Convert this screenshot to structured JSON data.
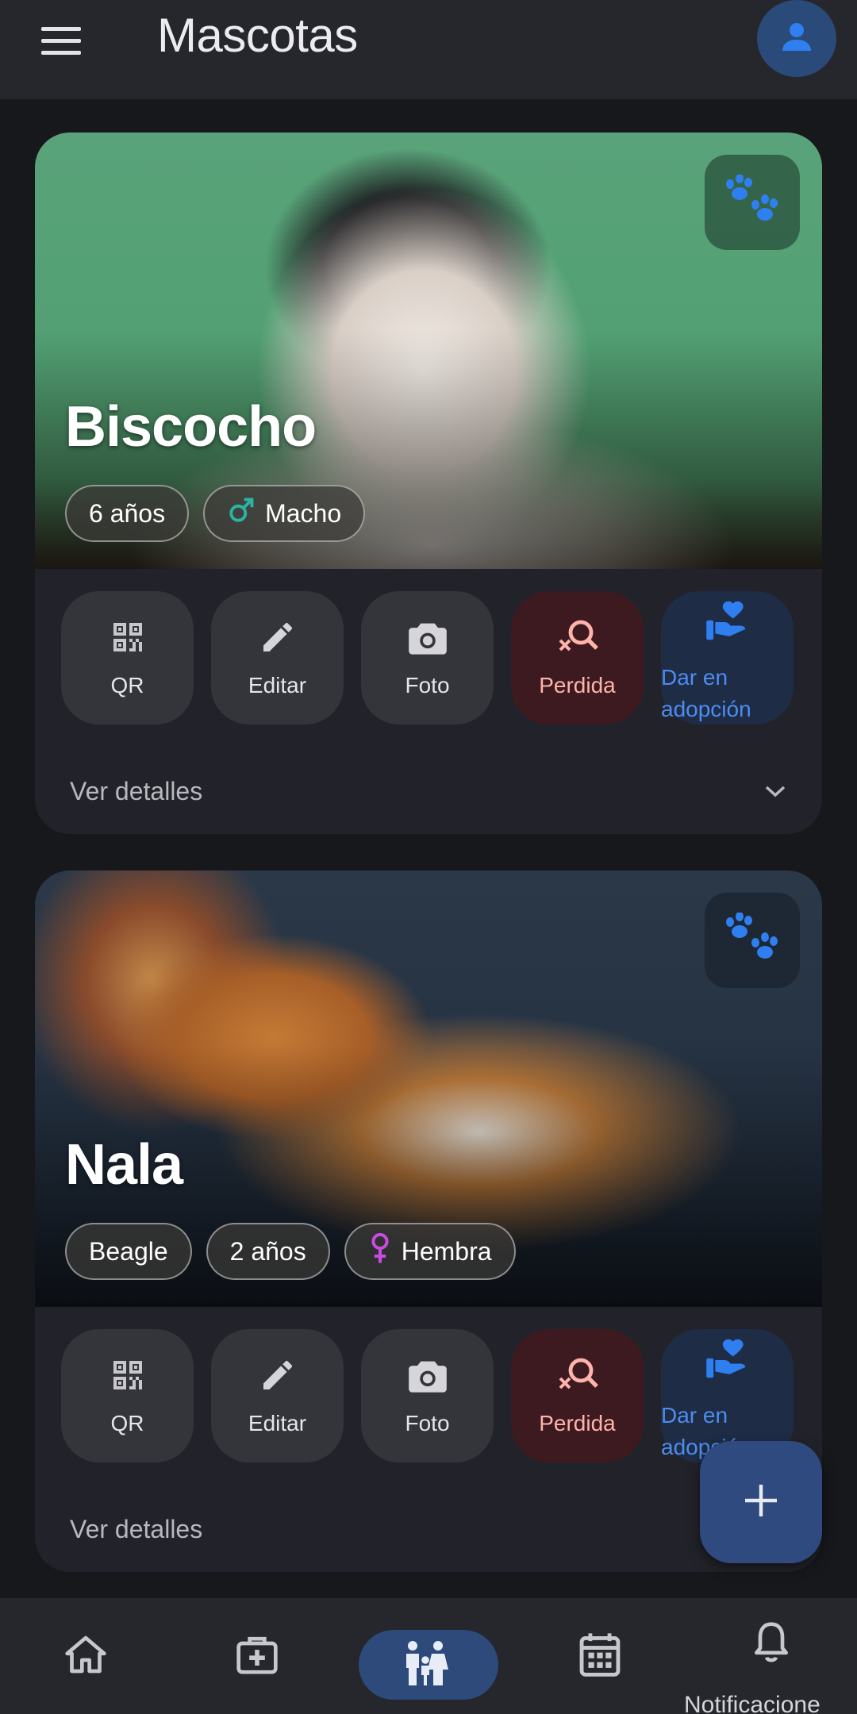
{
  "appbar": {
    "title": "Mascotas",
    "menu_icon": "menu-icon",
    "account_icon": "person-icon"
  },
  "pets": [
    {
      "name": "Biscocho",
      "chips": [
        "6 años",
        "Macho"
      ],
      "gender_icon": "male-icon",
      "gender_color": "#2bb3a3"
    },
    {
      "name": "Nala",
      "chips": [
        "Beagle",
        "2 años",
        "Hembra"
      ],
      "gender_icon": "female-icon",
      "gender_color": "#c94ce0"
    }
  ],
  "actions": {
    "qr": "QR",
    "edit": "Editar",
    "photo": "Foto",
    "lost": "Perdida",
    "adopt_line1": "Dar en",
    "adopt_line2": "adopción"
  },
  "details_label": "Ver detalles",
  "nav": {
    "items": [
      "home-icon",
      "medical-kit-icon",
      "family-icon",
      "calendar-icon",
      "bell-icon"
    ],
    "active_index": 2,
    "notifications_label": "Notificacione"
  },
  "colors": {
    "accent": "#4d8cf0",
    "lost_bg": "#3d1a20",
    "lost_fg": "#ffb4ab",
    "adopt_bg": "#1e2c45"
  }
}
